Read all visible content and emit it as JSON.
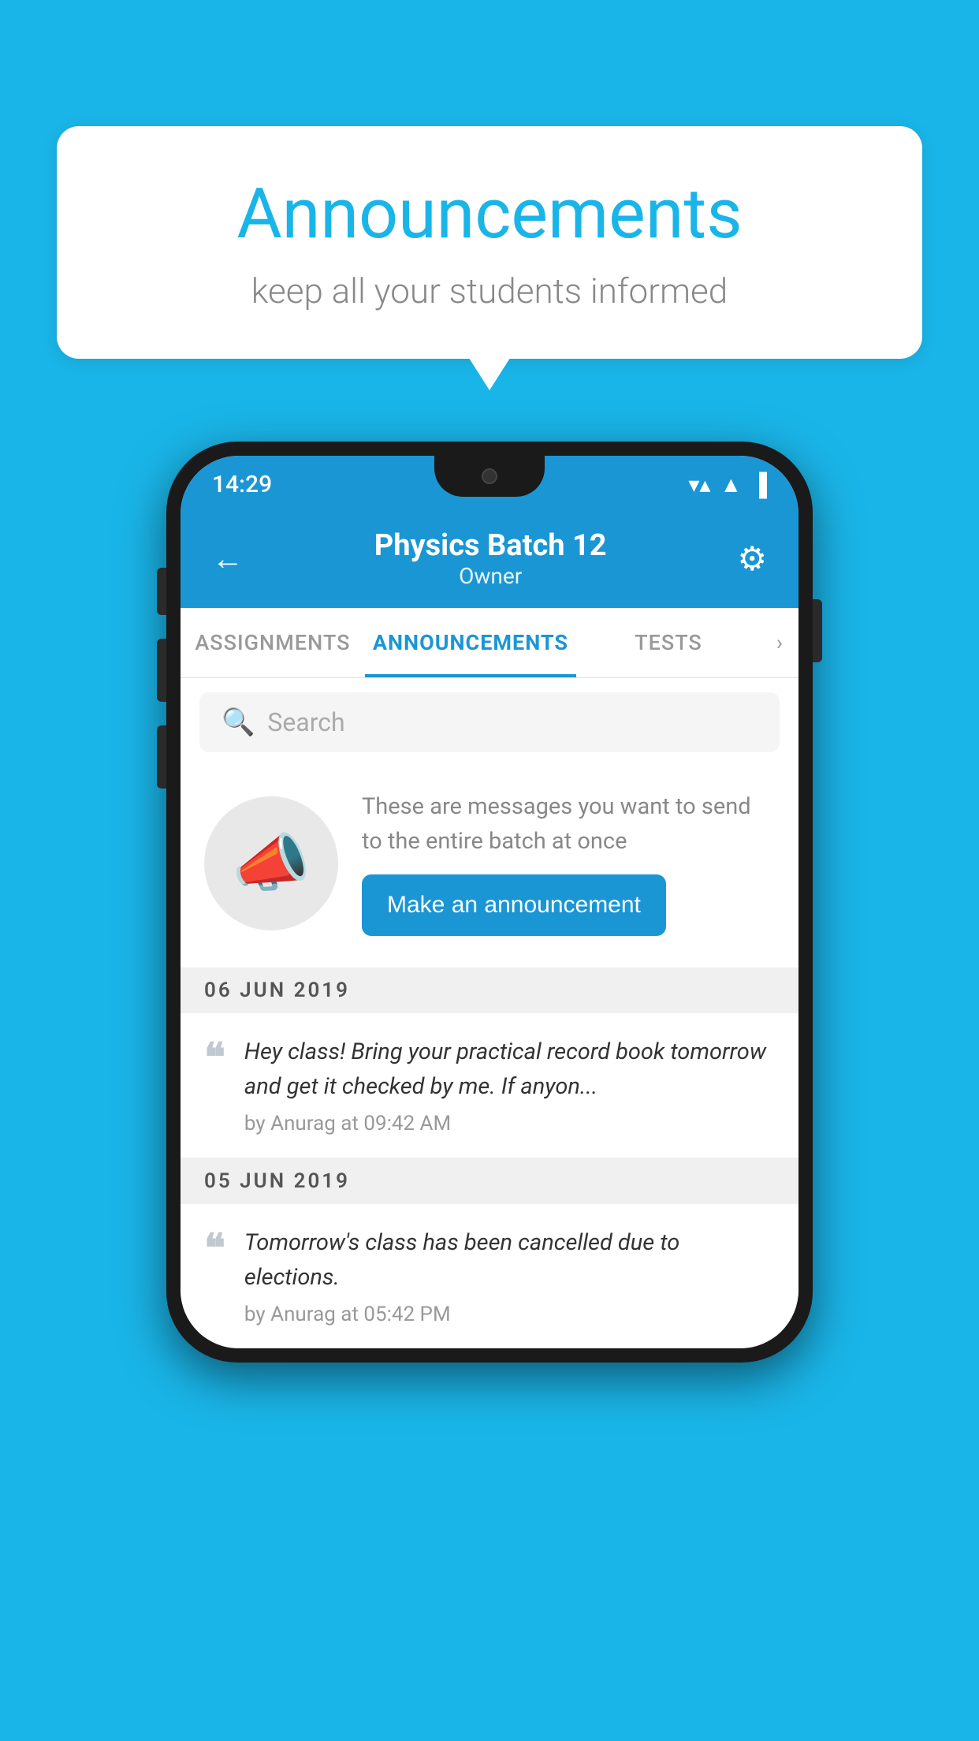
{
  "page": {
    "background_color": "#1ab5e8"
  },
  "speech_bubble": {
    "title": "Announcements",
    "subtitle": "keep all your students informed"
  },
  "phone": {
    "status_bar": {
      "time": "14:29",
      "wifi": "▼",
      "signal": "▲",
      "battery": "▐"
    },
    "header": {
      "back_label": "←",
      "title": "Physics Batch 12",
      "subtitle": "Owner",
      "settings_label": "⚙"
    },
    "tabs": [
      {
        "label": "ASSIGNMENTS",
        "active": false
      },
      {
        "label": "ANNOUNCEMENTS",
        "active": true
      },
      {
        "label": "TESTS",
        "active": false
      }
    ],
    "tabs_more": "›",
    "search": {
      "placeholder": "Search"
    },
    "promo": {
      "description": "These are messages you want to send to the entire batch at once",
      "button_label": "Make an announcement"
    },
    "date_groups": [
      {
        "date": "06  JUN  2019",
        "announcements": [
          {
            "text": "Hey class! Bring your practical record book tomorrow and get it checked by me. If anyon...",
            "meta": "by Anurag at 09:42 AM"
          }
        ]
      },
      {
        "date": "05  JUN  2019",
        "announcements": [
          {
            "text": "Tomorrow's class has been cancelled due to elections.",
            "meta": "by Anurag at 05:42 PM"
          }
        ]
      }
    ]
  }
}
